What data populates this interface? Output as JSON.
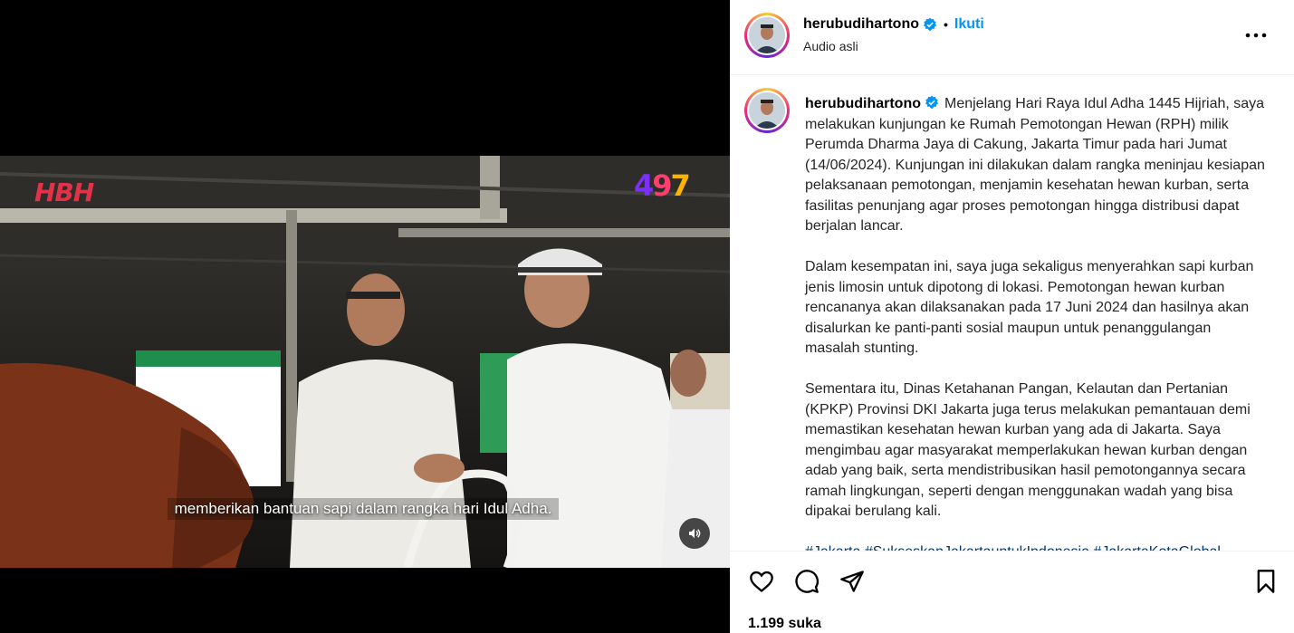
{
  "video": {
    "logo_left": "HBH",
    "logo_right_digits": [
      "4",
      "9",
      "7"
    ],
    "subtitle": "memberikan bantuan sapi dalam rangka hari Idul Adha.",
    "mute_icon": "speaker-icon"
  },
  "post_header": {
    "username": "herubudihartono",
    "separator": "•",
    "follow_label": "Ikuti",
    "audio_label": "Audio asli",
    "verified_icon": "verified-badge-icon",
    "more_icon": "more-options-icon"
  },
  "caption": {
    "username": "herubudihartono",
    "paragraphs": [
      "Menjelang Hari Raya Idul Adha 1445 Hijriah, saya melakukan kunjungan ke Rumah Pemotongan Hewan (RPH) milik Perumda Dharma Jaya di Cakung, Jakarta Timur pada hari Jumat (14/06/2024). Kunjungan ini dilakukan dalam rangka meninjau kesiapan pelaksanaan pemotongan, menjamin kesehatan hewan kurban, serta fasilitas penunjang agar proses pemotongan hingga distribusi dapat berjalan lancar.",
      "Dalam kesempatan ini, saya juga sekaligus menyerahkan sapi kurban jenis limosin untuk dipotong di lokasi. Pemotongan hewan kurban rencananya akan dilaksanakan pada 17 Juni 2024 dan hasilnya akan disalurkan ke panti-panti sosial maupun untuk penanggulangan masalah stunting.",
      "Sementara itu, Dinas Ketahanan Pangan, Kelautan dan Pertanian (KPKP) Provinsi DKI Jakarta juga terus melakukan pemantauan demi memastikan kesehatan hewan kurban yang ada di Jakarta. Saya mengimbau agar masyarakat memperlakukan hewan kurban dengan adab yang baik, serta mendistribusikan hasil pemotongannya secara ramah lingkungan, seperti dengan menggunakan wadah yang bisa dipakai berulang kali."
    ],
    "hashtags": "#Jakarta #SukseskanJakartauntukIndonesia #JakartaKotaGlobal"
  },
  "actions": {
    "like_icon": "heart-icon",
    "comment_icon": "comment-icon",
    "share_icon": "share-icon",
    "save_icon": "bookmark-icon",
    "likes_text": "1.199 suka"
  },
  "colors": {
    "follow_blue": "#0095f6",
    "hashtag_blue": "#00376b",
    "verified_blue": "#0095f6",
    "logo_red": "#e0334a"
  }
}
